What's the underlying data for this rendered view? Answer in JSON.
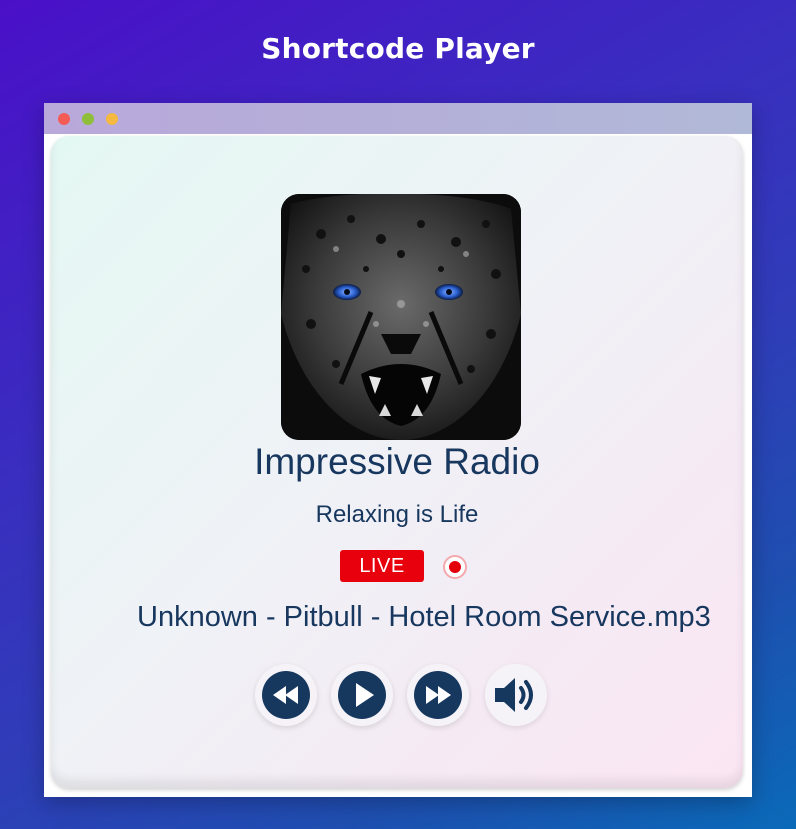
{
  "page": {
    "title": "Shortcode Player"
  },
  "window": {
    "controls": [
      "close",
      "minimize",
      "maximize"
    ]
  },
  "player": {
    "station_name": "Impressive Radio",
    "slogan": "Relaxing is Life",
    "live_label": "LIVE",
    "now_playing": "Unknown - Pitbull - Hotel Room Service.mp3",
    "artwork": "cheetah-artwork",
    "accent_color": "#16385f",
    "live_color": "#e8000c",
    "controls": {
      "previous": "rewind-icon",
      "play": "play-icon",
      "next": "fast-forward-icon",
      "volume": "volume-icon"
    }
  }
}
